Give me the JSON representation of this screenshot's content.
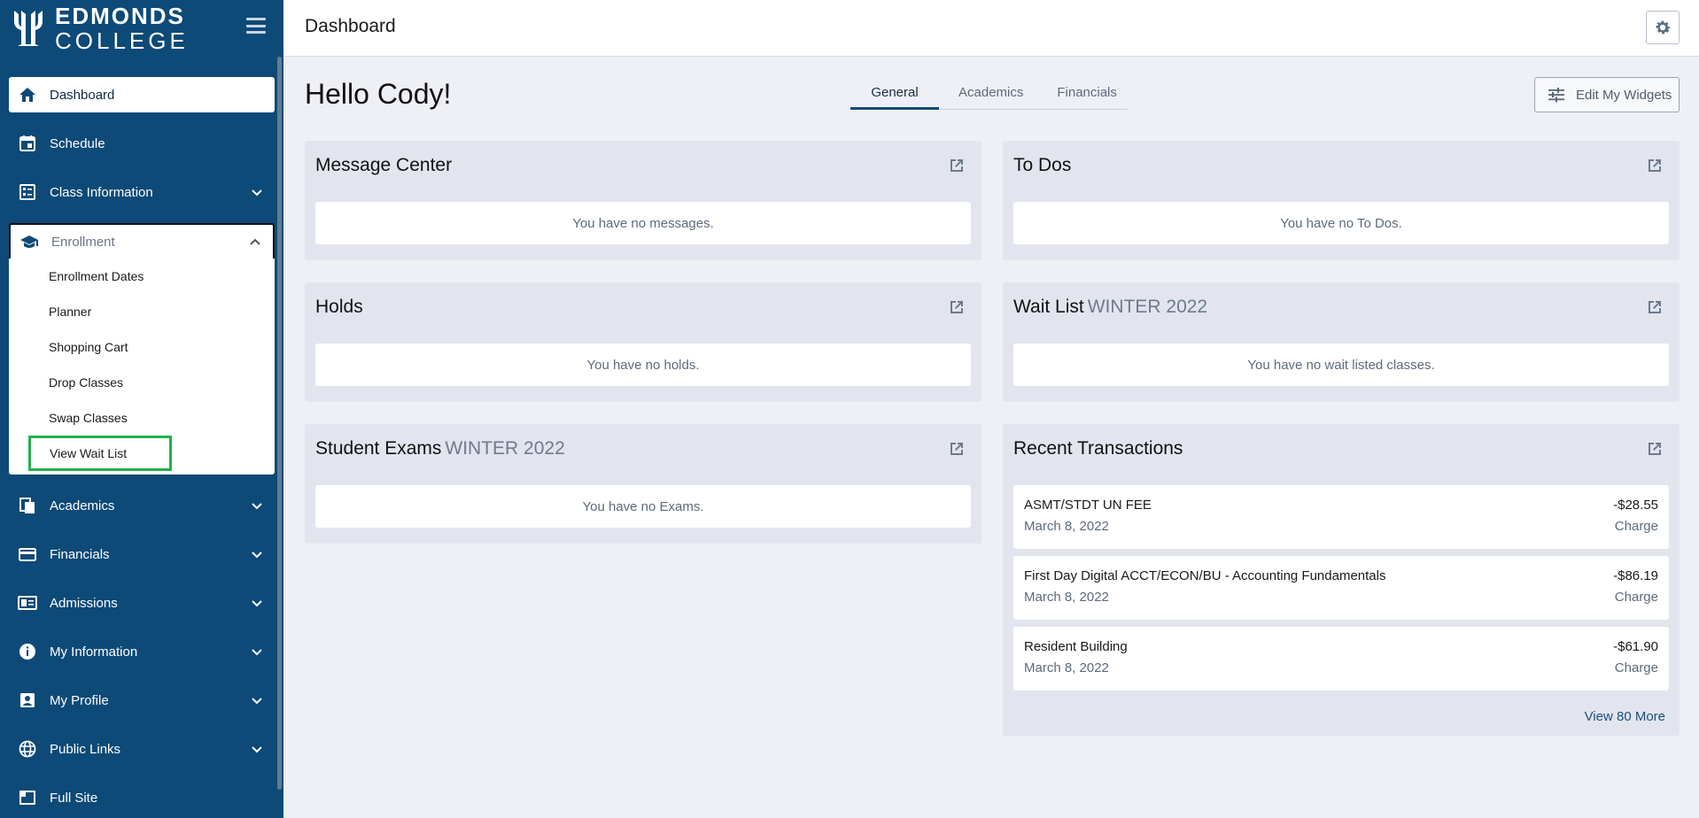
{
  "brand": {
    "line1": "EDMONDS",
    "line2": "COLLEGE"
  },
  "header": {
    "title": "Dashboard"
  },
  "sidebar": {
    "items": [
      {
        "label": "Dashboard",
        "icon": "home-icon"
      },
      {
        "label": "Schedule",
        "icon": "calendar-icon"
      },
      {
        "label": "Class Information",
        "icon": "list-icon"
      },
      {
        "label": "Enrollment",
        "icon": "graduation-cap-icon"
      },
      {
        "label": "Academics",
        "icon": "documents-icon"
      },
      {
        "label": "Financials",
        "icon": "credit-card-icon"
      },
      {
        "label": "Admissions",
        "icon": "id-card-icon"
      },
      {
        "label": "My Information",
        "icon": "info-icon"
      },
      {
        "label": "My Profile",
        "icon": "person-badge-icon"
      },
      {
        "label": "Public Links",
        "icon": "globe-icon"
      },
      {
        "label": "Full Site",
        "icon": "window-icon"
      }
    ],
    "enrollment_submenu": [
      "Enrollment Dates",
      "Planner",
      "Shopping Cart",
      "Drop Classes",
      "Swap Classes",
      "View Wait List"
    ]
  },
  "main": {
    "greeting": "Hello Cody!",
    "tabs": [
      {
        "label": "General"
      },
      {
        "label": "Academics"
      },
      {
        "label": "Financials"
      }
    ],
    "edit_widgets_label": "Edit My Widgets"
  },
  "widgets": {
    "message_center": {
      "title": "Message Center",
      "empty": "You have no messages."
    },
    "todos": {
      "title": "To Dos",
      "empty": "You have no To Dos."
    },
    "holds": {
      "title": "Holds",
      "empty": "You have no holds."
    },
    "wait_list": {
      "title": "Wait List",
      "term": "WINTER 2022",
      "empty": "You have no wait listed classes."
    },
    "student_exams": {
      "title": "Student Exams",
      "term": "WINTER 2022",
      "empty": "You have no Exams."
    },
    "recent_transactions": {
      "title": "Recent Transactions",
      "items": [
        {
          "description": "ASMT/STDT UN FEE",
          "date": "March 8, 2022",
          "amount": "-$28.55",
          "type": "Charge"
        },
        {
          "description": "First Day Digital ACCT/ECON/BU - Accounting Fundamentals",
          "date": "March 8, 2022",
          "amount": "-$86.19",
          "type": "Charge"
        },
        {
          "description": "Resident Building",
          "date": "March 8, 2022",
          "amount": "-$61.90",
          "type": "Charge"
        }
      ],
      "view_more": "View 80 More"
    }
  },
  "colors": {
    "sidebar": "#0d4a77",
    "highlight": "#21b24b",
    "background": "#eef0f5",
    "widget": "#e2e5ee"
  }
}
